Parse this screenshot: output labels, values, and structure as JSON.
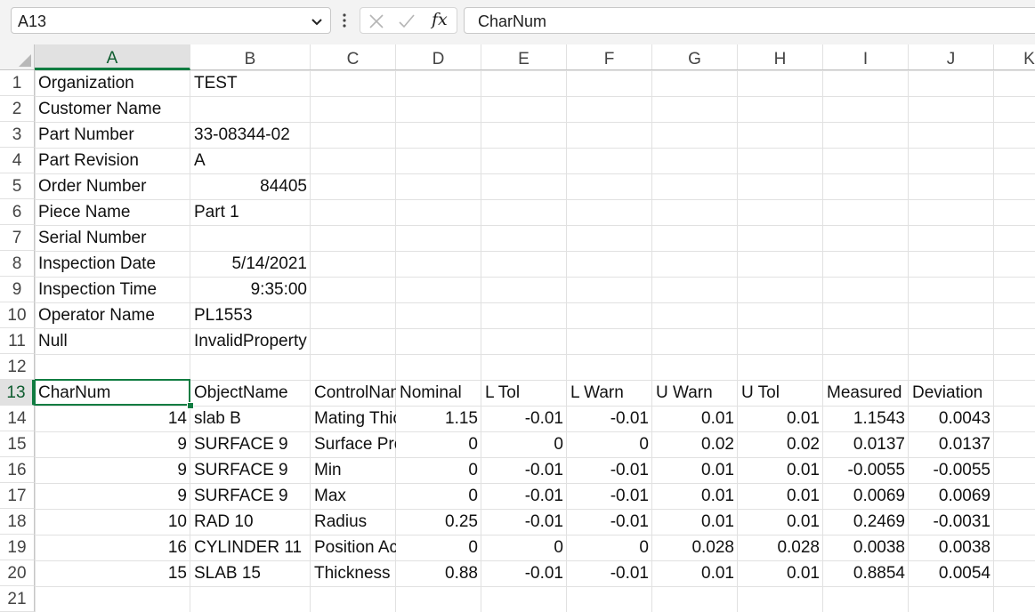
{
  "name_box": {
    "value": "A13"
  },
  "formula_bar": {
    "fx": "fx",
    "value": "CharNum"
  },
  "columns": [
    "A",
    "B",
    "C",
    "D",
    "E",
    "F",
    "G",
    "H",
    "I",
    "J",
    "K"
  ],
  "active_column": "A",
  "active_row": 13,
  "rows": [
    {
      "n": 1,
      "cells": [
        {
          "col": "A",
          "v": "Organization"
        },
        {
          "col": "B",
          "v": "TEST"
        }
      ]
    },
    {
      "n": 2,
      "cells": [
        {
          "col": "A",
          "v": "Customer Name"
        }
      ]
    },
    {
      "n": 3,
      "cells": [
        {
          "col": "A",
          "v": "Part Number"
        },
        {
          "col": "B",
          "v": "33-08344-02"
        }
      ]
    },
    {
      "n": 4,
      "cells": [
        {
          "col": "A",
          "v": "Part Revision"
        },
        {
          "col": "B",
          "v": "A"
        }
      ]
    },
    {
      "n": 5,
      "cells": [
        {
          "col": "A",
          "v": "Order Number"
        },
        {
          "col": "B",
          "v": "84405",
          "num": true
        }
      ]
    },
    {
      "n": 6,
      "cells": [
        {
          "col": "A",
          "v": "Piece Name"
        },
        {
          "col": "B",
          "v": "Part 1"
        }
      ]
    },
    {
      "n": 7,
      "cells": [
        {
          "col": "A",
          "v": "Serial Number"
        }
      ]
    },
    {
      "n": 8,
      "cells": [
        {
          "col": "A",
          "v": "Inspection Date"
        },
        {
          "col": "B",
          "v": "5/14/2021",
          "num": true
        }
      ]
    },
    {
      "n": 9,
      "cells": [
        {
          "col": "A",
          "v": "Inspection Time"
        },
        {
          "col": "B",
          "v": "9:35:00",
          "num": true
        }
      ]
    },
    {
      "n": 10,
      "cells": [
        {
          "col": "A",
          "v": "Operator Name"
        },
        {
          "col": "B",
          "v": "PL1553"
        }
      ]
    },
    {
      "n": 11,
      "cells": [
        {
          "col": "A",
          "v": "Null"
        },
        {
          "col": "B",
          "v": "InvalidProperty",
          "overflow": true
        }
      ]
    },
    {
      "n": 12,
      "cells": []
    },
    {
      "n": 13,
      "cells": [
        {
          "col": "A",
          "v": "CharNum"
        },
        {
          "col": "B",
          "v": "ObjectName"
        },
        {
          "col": "C",
          "v": "ControlName"
        },
        {
          "col": "D",
          "v": "Nominal"
        },
        {
          "col": "E",
          "v": "L Tol"
        },
        {
          "col": "F",
          "v": "L Warn"
        },
        {
          "col": "G",
          "v": "U Warn"
        },
        {
          "col": "H",
          "v": "U Tol"
        },
        {
          "col": "I",
          "v": "Measured"
        },
        {
          "col": "J",
          "v": "Deviation"
        }
      ]
    },
    {
      "n": 14,
      "cells": [
        {
          "col": "A",
          "v": "14",
          "num": true
        },
        {
          "col": "B",
          "v": "slab B"
        },
        {
          "col": "C",
          "v": "Mating Thickness"
        },
        {
          "col": "D",
          "v": "1.15",
          "num": true
        },
        {
          "col": "E",
          "v": "-0.01",
          "num": true
        },
        {
          "col": "F",
          "v": "-0.01",
          "num": true
        },
        {
          "col": "G",
          "v": "0.01",
          "num": true
        },
        {
          "col": "H",
          "v": "0.01",
          "num": true
        },
        {
          "col": "I",
          "v": "1.1543",
          "num": true
        },
        {
          "col": "J",
          "v": "0.0043",
          "num": true
        }
      ]
    },
    {
      "n": 15,
      "cells": [
        {
          "col": "A",
          "v": "9",
          "num": true
        },
        {
          "col": "B",
          "v": "SURFACE 9"
        },
        {
          "col": "C",
          "v": "Surface Profile"
        },
        {
          "col": "D",
          "v": "0",
          "num": true
        },
        {
          "col": "E",
          "v": "0",
          "num": true
        },
        {
          "col": "F",
          "v": "0",
          "num": true
        },
        {
          "col": "G",
          "v": "0.02",
          "num": true
        },
        {
          "col": "H",
          "v": "0.02",
          "num": true
        },
        {
          "col": "I",
          "v": "0.0137",
          "num": true
        },
        {
          "col": "J",
          "v": "0.0137",
          "num": true
        }
      ]
    },
    {
      "n": 16,
      "cells": [
        {
          "col": "A",
          "v": "9",
          "num": true
        },
        {
          "col": "B",
          "v": "SURFACE 9"
        },
        {
          "col": "C",
          "v": "Min"
        },
        {
          "col": "D",
          "v": "0",
          "num": true
        },
        {
          "col": "E",
          "v": "-0.01",
          "num": true
        },
        {
          "col": "F",
          "v": "-0.01",
          "num": true
        },
        {
          "col": "G",
          "v": "0.01",
          "num": true
        },
        {
          "col": "H",
          "v": "0.01",
          "num": true
        },
        {
          "col": "I",
          "v": "-0.0055",
          "num": true
        },
        {
          "col": "J",
          "v": "-0.0055",
          "num": true
        }
      ]
    },
    {
      "n": 17,
      "cells": [
        {
          "col": "A",
          "v": "9",
          "num": true
        },
        {
          "col": "B",
          "v": "SURFACE 9"
        },
        {
          "col": "C",
          "v": "Max"
        },
        {
          "col": "D",
          "v": "0",
          "num": true
        },
        {
          "col": "E",
          "v": "-0.01",
          "num": true
        },
        {
          "col": "F",
          "v": "-0.01",
          "num": true
        },
        {
          "col": "G",
          "v": "0.01",
          "num": true
        },
        {
          "col": "H",
          "v": "0.01",
          "num": true
        },
        {
          "col": "I",
          "v": "0.0069",
          "num": true
        },
        {
          "col": "J",
          "v": "0.0069",
          "num": true
        }
      ]
    },
    {
      "n": 18,
      "cells": [
        {
          "col": "A",
          "v": "10",
          "num": true
        },
        {
          "col": "B",
          "v": "RAD 10"
        },
        {
          "col": "C",
          "v": "Radius"
        },
        {
          "col": "D",
          "v": "0.25",
          "num": true
        },
        {
          "col": "E",
          "v": "-0.01",
          "num": true
        },
        {
          "col": "F",
          "v": "-0.01",
          "num": true
        },
        {
          "col": "G",
          "v": "0.01",
          "num": true
        },
        {
          "col": "H",
          "v": "0.01",
          "num": true
        },
        {
          "col": "I",
          "v": "0.2469",
          "num": true
        },
        {
          "col": "J",
          "v": "-0.0031",
          "num": true
        }
      ]
    },
    {
      "n": 19,
      "cells": [
        {
          "col": "A",
          "v": "16",
          "num": true
        },
        {
          "col": "B",
          "v": "CYLINDER 11"
        },
        {
          "col": "C",
          "v": "Position Actual"
        },
        {
          "col": "D",
          "v": "0",
          "num": true
        },
        {
          "col": "E",
          "v": "0",
          "num": true
        },
        {
          "col": "F",
          "v": "0",
          "num": true
        },
        {
          "col": "G",
          "v": "0.028",
          "num": true
        },
        {
          "col": "H",
          "v": "0.028",
          "num": true
        },
        {
          "col": "I",
          "v": "0.0038",
          "num": true
        },
        {
          "col": "J",
          "v": "0.0038",
          "num": true
        }
      ]
    },
    {
      "n": 20,
      "cells": [
        {
          "col": "A",
          "v": "15",
          "num": true
        },
        {
          "col": "B",
          "v": "SLAB 15"
        },
        {
          "col": "C",
          "v": "Thickness"
        },
        {
          "col": "D",
          "v": "0.88",
          "num": true
        },
        {
          "col": "E",
          "v": "-0.01",
          "num": true
        },
        {
          "col": "F",
          "v": "-0.01",
          "num": true
        },
        {
          "col": "G",
          "v": "0.01",
          "num": true
        },
        {
          "col": "H",
          "v": "0.01",
          "num": true
        },
        {
          "col": "I",
          "v": "0.8854",
          "num": true
        },
        {
          "col": "J",
          "v": "0.0054",
          "num": true
        }
      ]
    },
    {
      "n": 21,
      "cells": []
    }
  ]
}
